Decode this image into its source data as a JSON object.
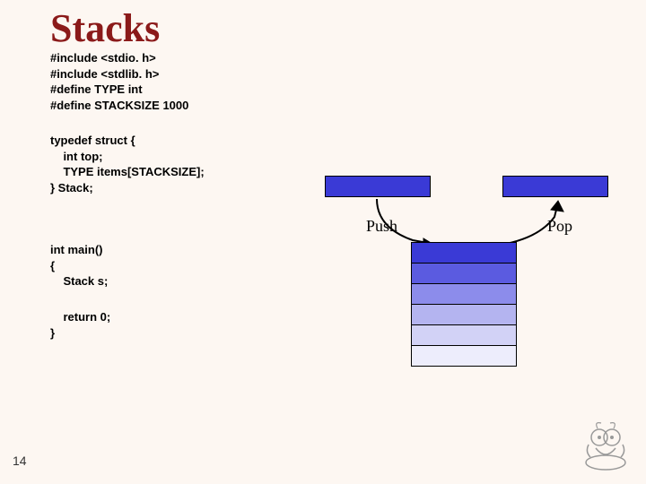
{
  "title": "Stacks",
  "code": {
    "block1": "#include <stdio. h>\n#include <stdlib. h>\n#define TYPE int\n#define STACKSIZE 1000",
    "block2": "typedef struct {\n    int top;\n    TYPE items[STACKSIZE];\n} Stack;",
    "block3": "int main()\n{\n    Stack s;",
    "block4": "    return 0;\n}"
  },
  "diagram": {
    "push_label": "Push",
    "pop_label": "Pop",
    "cell_colors": [
      "#3a3ad6",
      "#5b5be0",
      "#8c8ceb",
      "#b4b4f0",
      "#d2d2f6",
      "#ededfc"
    ]
  },
  "slide_number": "14"
}
